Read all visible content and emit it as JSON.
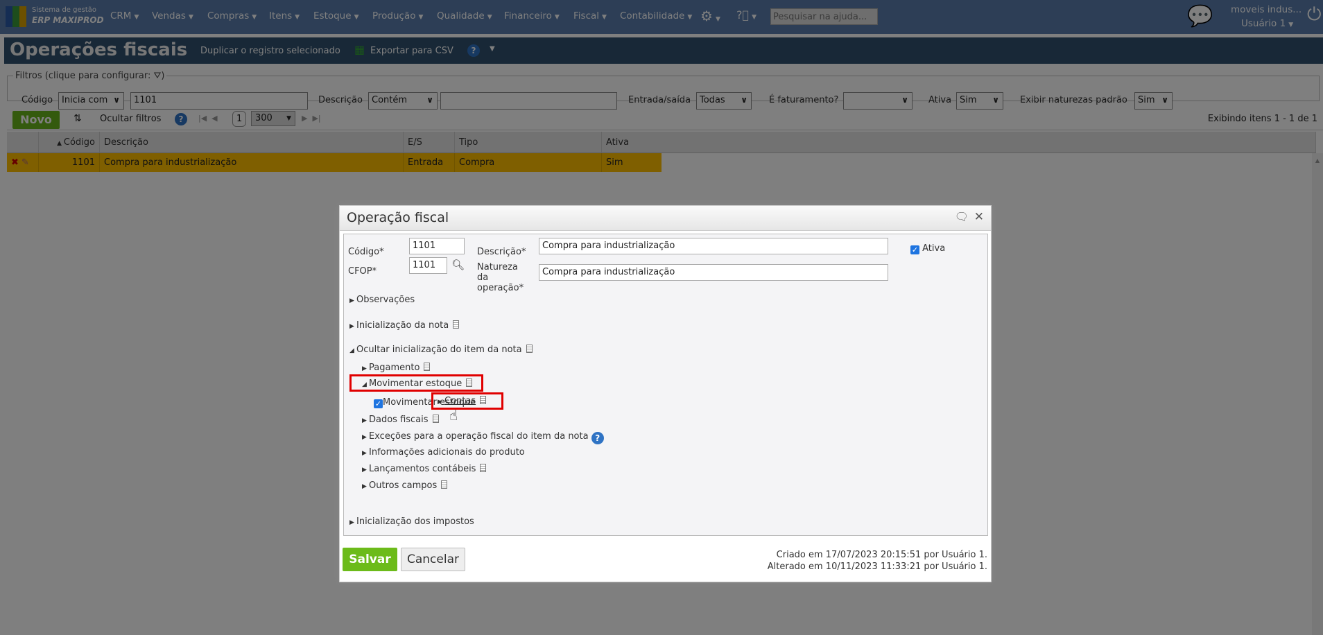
{
  "nav": {
    "logo_line1": "Sistema de gestão",
    "logo_line2": "ERP MAXIPROD",
    "menus": [
      "CRM",
      "Vendas",
      "Compras",
      "Itens",
      "Estoque",
      "Produção",
      "Qualidade",
      "Financeiro",
      "Fiscal",
      "Contabilidade"
    ],
    "help_search_placeholder": "Pesquisar na ajuda...",
    "company": "moveis indus...",
    "user": "Usuário 1"
  },
  "page": {
    "title": "Operações fiscais",
    "duplicate": "Duplicar o registro selecionado",
    "export": "Exportar para CSV"
  },
  "filters": {
    "legend": "Filtros (clique para configurar:",
    "legend_end": ")",
    "codigo_label": "Código",
    "codigo_op": "Inicia com",
    "codigo_value": "1101",
    "descricao_label": "Descrição",
    "descricao_op": "Contém",
    "descricao_value": "",
    "es_label": "Entrada/saída",
    "es_value": "Todas",
    "fat_label": "É faturamento?",
    "fat_value": "",
    "ativa_label": "Ativa",
    "ativa_value": "Sim",
    "naturezas_label": "Exibir naturezas padrão",
    "naturezas_value": "Sim"
  },
  "toolbar": {
    "novo": "Novo",
    "hide_filters": "Ocultar filtros",
    "page": "1",
    "page_size": "300",
    "showing": "Exibindo itens 1 - 1 de 1"
  },
  "grid": {
    "columns": [
      "Código",
      "Descrição",
      "E/S",
      "Tipo",
      "Ativa"
    ],
    "rows": [
      {
        "codigo": "1101",
        "descricao": "Compra para industrialização",
        "es": "Entrada",
        "tipo": "Compra",
        "ativa": "Sim"
      }
    ]
  },
  "dialog": {
    "title": "Operação fiscal",
    "codigo_label": "Código*",
    "codigo": "1101",
    "cfop_label": "CFOP*",
    "cfop": "1101",
    "descricao_label": "Descrição*",
    "descricao": "Compra para industrialização",
    "natureza_label1": "Natureza",
    "natureza_label2": "da",
    "natureza_label3": "operação*",
    "natureza": "Compra para industrialização",
    "ativa_label": "Ativa",
    "ativa_checked": true,
    "sections": {
      "observacoes": "Observações",
      "inic_nota": "Inicialização da nota",
      "ocultar_item": "Ocultar inicialização do item da nota",
      "pagamento": "Pagamento",
      "movimentar": "Movimentar estoque",
      "movimentar_cb": "Movimentar estoque",
      "contas": "Contas",
      "dados_fiscais": "Dados fiscais",
      "excecoes": "Exceções para a operação fiscal do item da nota",
      "info_adic": "Informações adicionais do produto",
      "lancamentos": "Lançamentos contábeis",
      "outros": "Outros campos",
      "impostos": "Inicialização dos impostos"
    },
    "salvar": "Salvar",
    "cancelar": "Cancelar",
    "criado": "Criado em 17/07/2023 20:15:51 por Usuário 1.",
    "alterado": "Alterado em 10/11/2023 11:33:21 por Usuário 1."
  },
  "colors": {
    "nav": "#5a7dad",
    "title_bar": "#31516f",
    "selected_row": "#ffbe00",
    "primary_button": "#6cbb1a",
    "highlight": "#e00000"
  }
}
